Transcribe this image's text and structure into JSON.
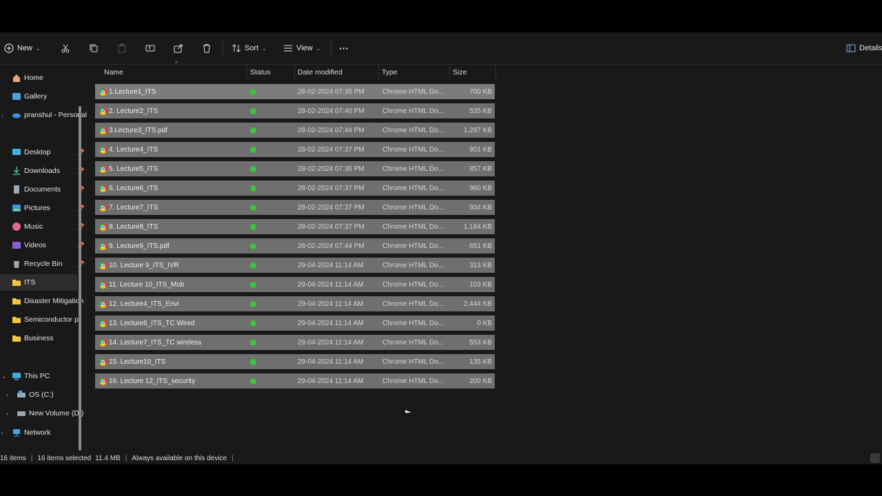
{
  "toolbar": {
    "new_label": "New",
    "sort_label": "Sort",
    "view_label": "View",
    "more_label": "···",
    "details_label": "Details"
  },
  "nav": {
    "items": [
      {
        "label": "Home",
        "icon": "home-icon"
      },
      {
        "label": "Gallery",
        "icon": "gallery-icon"
      },
      {
        "label": "pranshul - Personal",
        "icon": "onedrive-icon"
      },
      {
        "label": "Desktop",
        "icon": "desktop-icon"
      },
      {
        "label": "Downloads",
        "icon": "downloads-icon"
      },
      {
        "label": "Documents",
        "icon": "documents-icon"
      },
      {
        "label": "Pictures",
        "icon": "pictures-icon"
      },
      {
        "label": "Music",
        "icon": "music-icon"
      },
      {
        "label": "Videos",
        "icon": "videos-icon"
      },
      {
        "label": "Recycle Bin",
        "icon": "recycle-bin-icon"
      },
      {
        "label": "ITS",
        "icon": "folder-icon"
      },
      {
        "label": "Disaster Mitigation",
        "icon": "folder-icon"
      },
      {
        "label": "Semiconductor p",
        "icon": "folder-icon"
      },
      {
        "label": "Business",
        "icon": "folder-icon"
      },
      {
        "label": "This PC",
        "icon": "pc-icon"
      },
      {
        "label": "OS (C:)",
        "icon": "drive-icon"
      },
      {
        "label": "New Volume (D:)",
        "icon": "drive-icon"
      },
      {
        "label": "Network",
        "icon": "network-icon"
      }
    ]
  },
  "columns": {
    "name": "Name",
    "status": "Status",
    "date": "Date modified",
    "type": "Type",
    "size": "Size"
  },
  "files": [
    {
      "name": "1.Lecture1_ITS",
      "date": "28-02-2024 07:35 PM",
      "type": "Chrome HTML Do...",
      "size": "700 KB"
    },
    {
      "name": "2. Lecture2_ITS",
      "date": "28-02-2024 07:40 PM",
      "type": "Chrome HTML Do...",
      "size": "535 KB"
    },
    {
      "name": "3.Lecture3_ITS.pdf",
      "date": "28-02-2024 07:44 PM",
      "type": "Chrome HTML Do...",
      "size": "1,297 KB"
    },
    {
      "name": "4. Lecture4_ITS",
      "date": "28-02-2024 07:37 PM",
      "type": "Chrome HTML Do...",
      "size": "901 KB"
    },
    {
      "name": "5. Lecture5_ITS",
      "date": "28-02-2024 07:36 PM",
      "type": "Chrome HTML Do...",
      "size": "857 KB"
    },
    {
      "name": "6. Lecture6_ITS",
      "date": "28-02-2024 07:37 PM",
      "type": "Chrome HTML Do...",
      "size": "960 KB"
    },
    {
      "name": "7. Lecture7_ITS",
      "date": "28-02-2024 07:37 PM",
      "type": "Chrome HTML Do...",
      "size": "934 KB"
    },
    {
      "name": "8. Lecture8_ITS",
      "date": "28-02-2024 07:37 PM",
      "type": "Chrome HTML Do...",
      "size": "1,184 KB"
    },
    {
      "name": "9. Lecture9_ITS.pdf",
      "date": "28-02-2024 07:44 PM",
      "type": "Chrome HTML Do...",
      "size": "651 KB"
    },
    {
      "name": "10. Lecture 9_ITS_IVR",
      "date": "29-04-2024 11:14 AM",
      "type": "Chrome HTML Do...",
      "size": "313 KB"
    },
    {
      "name": "11. Lecture 10_ITS_Mob",
      "date": "29-04-2024 11:14 AM",
      "type": "Chrome HTML Do...",
      "size": "103 KB"
    },
    {
      "name": "12. Lecture4_ITS_Envi",
      "date": "29-04-2024 11:14 AM",
      "type": "Chrome HTML Do...",
      "size": "2,444 KB"
    },
    {
      "name": "13. Lecture6_ITS_TC Wired",
      "date": "29-04-2024 11:14 AM",
      "type": "Chrome HTML Do...",
      "size": "0 KB"
    },
    {
      "name": "14. Lecture7_ITS_TC wireless",
      "date": "29-04-2024 11:14 AM",
      "type": "Chrome HTML Do...",
      "size": "553 KB"
    },
    {
      "name": "15. Lecture10_ITS",
      "date": "29-04-2024 11:14 AM",
      "type": "Chrome HTML Do...",
      "size": "135 KB"
    },
    {
      "name": "16. Lecture 12_ITS_security",
      "date": "29-04-2024 11:14 AM",
      "type": "Chrome HTML Do...",
      "size": "200 KB"
    }
  ],
  "statusbar": {
    "count": "16 items",
    "selected": "16 items selected",
    "size": "11.4 MB",
    "availability": "Always available on this device"
  },
  "colors": {
    "selection": "#6f6f6f",
    "synced": "#3cc43c",
    "background": "#191919"
  }
}
